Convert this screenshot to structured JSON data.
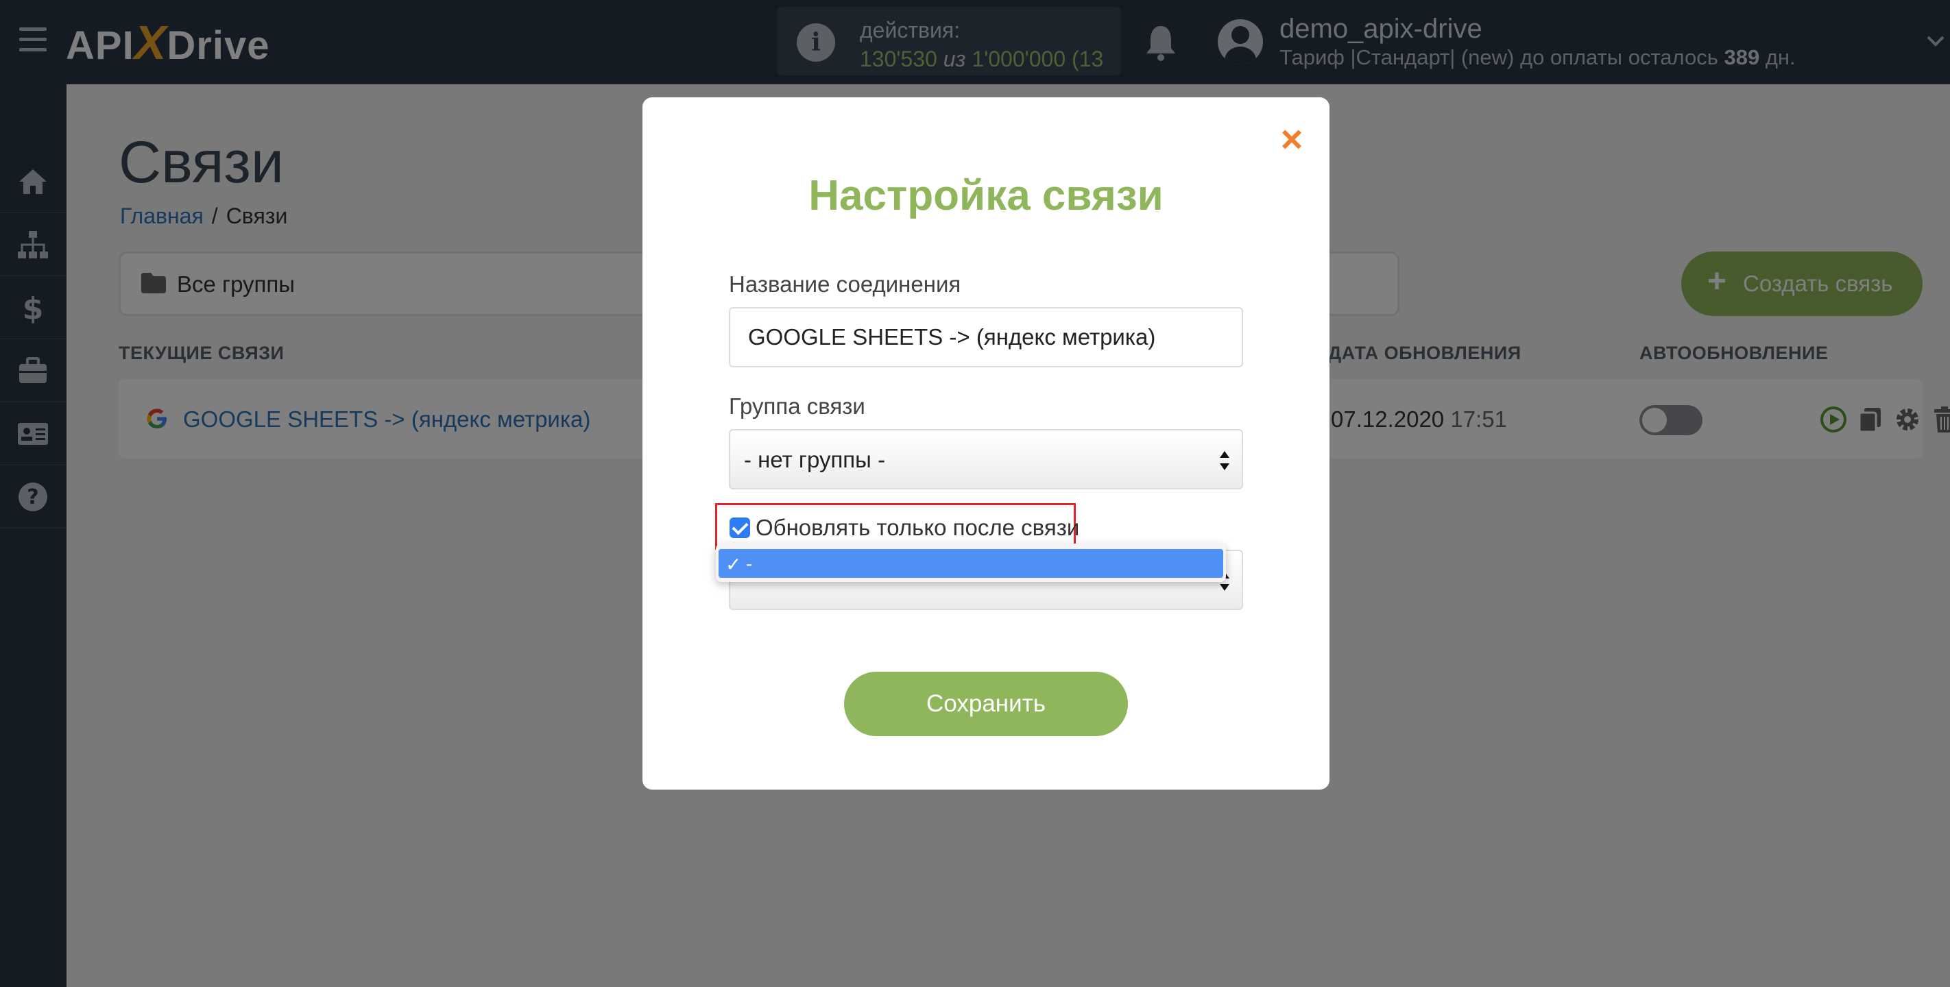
{
  "app": {
    "logo_left": "API",
    "logo_x": "X",
    "logo_right": "Drive"
  },
  "topbar": {
    "actions_label": "действия:",
    "actions_used": "130'530",
    "actions_of": "из",
    "actions_total": "1'000'000",
    "actions_extra": "(13",
    "user_name": "demo_apix-drive",
    "plan_text": "Тариф |Стандарт| (new) до оплаты осталось",
    "plan_days": "389",
    "plan_days_unit": "дн."
  },
  "sidebar": {
    "items": [
      {
        "icon": "home-icon"
      },
      {
        "icon": "sitemap-icon"
      },
      {
        "icon": "dollar-icon"
      },
      {
        "icon": "briefcase-icon"
      },
      {
        "icon": "id-card-icon"
      },
      {
        "icon": "help-icon"
      }
    ]
  },
  "page": {
    "title": "Связи",
    "breadcrumb": {
      "home": "Главная",
      "separator": "/",
      "current": "Связи"
    },
    "group_filter": "Все группы",
    "create_button": "Создать связь",
    "create_plus": "+",
    "columns": {
      "current": "ТЕКУЩИЕ СВЯЗИ",
      "update_date": "ДАТА ОБНОВЛЕНИЯ",
      "auto_update": "АВТООБНОВЛЕНИЕ"
    },
    "rows": [
      {
        "name": "GOOGLE SHEETS -> (яндекс метрика)",
        "date": "07.12.2020",
        "time": "17:51",
        "auto_update": false
      }
    ]
  },
  "modal": {
    "title": "Настройка связи",
    "close": "×",
    "name_label": "Название соединения",
    "name_value": "GOOGLE SHEETS -> (яндекс метрика)",
    "group_label": "Группа связи",
    "group_value": "- нет группы -",
    "checkbox_label": "Обновлять только после связи",
    "checkbox_checked": true,
    "dropdown_option": "-",
    "dropdown_check": "✓",
    "save_button": "Сохранить"
  },
  "colors": {
    "topbar": "#2b3744",
    "accent_green": "#8fb65a",
    "close_orange": "#f07f2b",
    "highlight_red": "#e0262b",
    "link_blue": "#2c72b8",
    "dropdown_selected": "#4f90f6"
  }
}
